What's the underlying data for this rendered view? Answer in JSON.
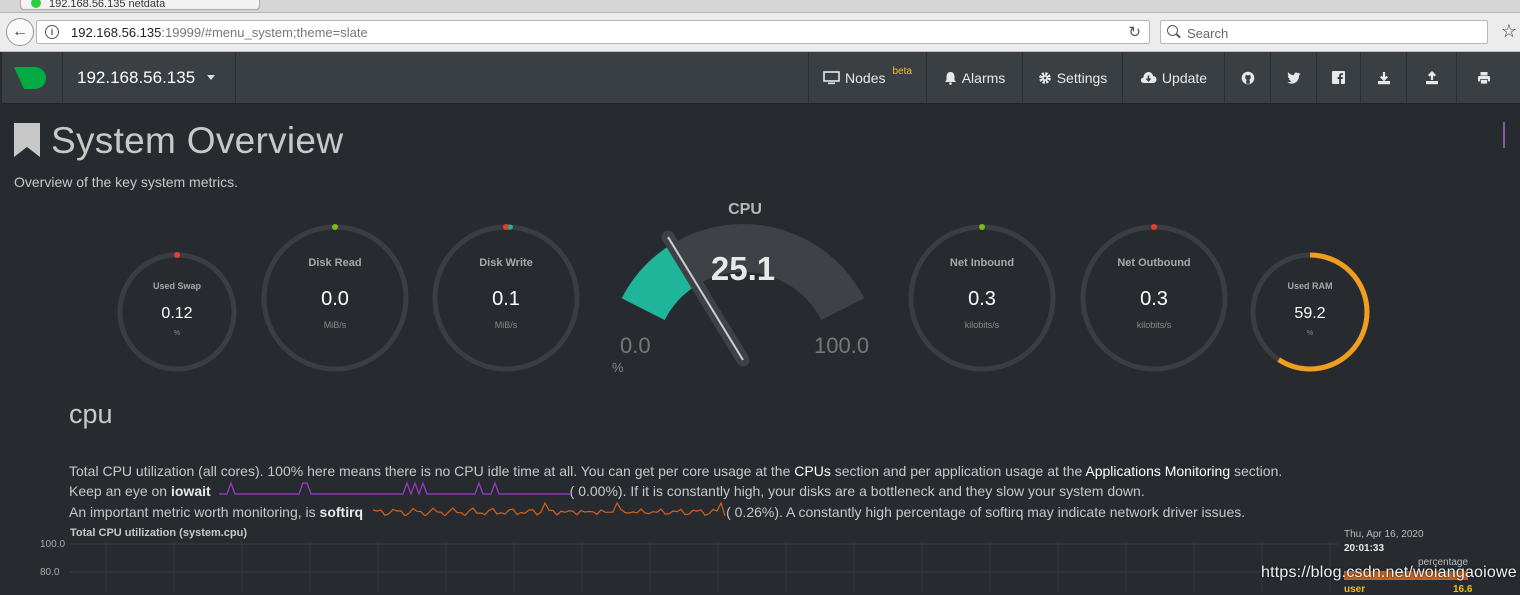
{
  "browser": {
    "tab_title": "192.168.56.135 netdata",
    "url_host": "192.168.56.135",
    "url_rest": ":19999/#menu_system;theme=slate",
    "search_placeholder": "Search"
  },
  "navbar": {
    "host": "192.168.56.135",
    "items": [
      {
        "label": "Nodes",
        "badge": "beta",
        "icon": "monitor-icon"
      },
      {
        "label": "Alarms",
        "icon": "bell-icon"
      },
      {
        "label": "Settings",
        "icon": "gear-icon"
      },
      {
        "label": "Update",
        "icon": "cloud-download-icon"
      }
    ],
    "icon_buttons": [
      "github-icon",
      "twitter-icon",
      "facebook-icon",
      "download-icon",
      "upload-icon",
      "print-icon"
    ]
  },
  "page": {
    "title": "System Overview",
    "subtitle": "Overview of the key system metrics."
  },
  "gauges": [
    {
      "title": "Used Swap",
      "value": "0.12",
      "unit": "%",
      "fraction": 0.0012,
      "dot": "#e0402a"
    },
    {
      "title": "Disk Read",
      "value": "0.0",
      "unit": "MiB/s",
      "fraction": 0.0,
      "dot": "#7cb81e"
    },
    {
      "title": "Disk Write",
      "value": "0.1",
      "unit": "MiB/s",
      "fraction": 0.01,
      "dot": "#e0402a"
    },
    {
      "title": "Net Inbound",
      "value": "0.3",
      "unit": "kilobits/s",
      "fraction": 0.0,
      "dot": "#7cb81e"
    },
    {
      "title": "Net Outbound",
      "value": "0.3",
      "unit": "kilobits/s",
      "fraction": 0.0,
      "dot": "#e0402a"
    },
    {
      "title": "Used RAM",
      "value": "59.2",
      "unit": "%",
      "fraction": 0.592,
      "color": "#f19e1f"
    }
  ],
  "cpu_gauge": {
    "title": "CPU",
    "value": "25.1",
    "min": "0.0",
    "max": "100.0",
    "unit": "%",
    "fraction": 0.251,
    "color": "#1fb59a"
  },
  "cpu_section": {
    "heading": "cpu",
    "desc1_a": "Total CPU utilization (all cores). 100% here means there is no CPU idle time at all. You can get per core usage at the ",
    "desc1_link1": "CPUs",
    "desc1_b": " section and per application usage at the ",
    "desc1_link2": "Applications Monitoring",
    "desc1_c": " section.",
    "desc2_a": "Keep an eye on ",
    "desc2_bold": "iowait",
    "desc2_val": "(      0.00%). If it is constantly high, your disks are a bottleneck and they slow your system down.",
    "desc3_a": "An important metric worth monitoring, is ",
    "desc3_bold": "softirq",
    "desc3_val": "(      0.26%). A constantly high percentage of softirq may indicate network driver issues.",
    "iowait_color": "#9b3dc9",
    "softirq_color": "#d4621a"
  },
  "chart": {
    "title": "Total CPU utilization (system.cpu)",
    "yticks": [
      "100.0",
      "80.0"
    ],
    "legend_date": "Thu, Apr 16, 2020",
    "legend_time": "20:01:33",
    "legend_unit": "percentage",
    "legend_series": "user",
    "legend_value": "16.6"
  },
  "watermark": "https://blog.csdn.net/woiangaoiowe"
}
